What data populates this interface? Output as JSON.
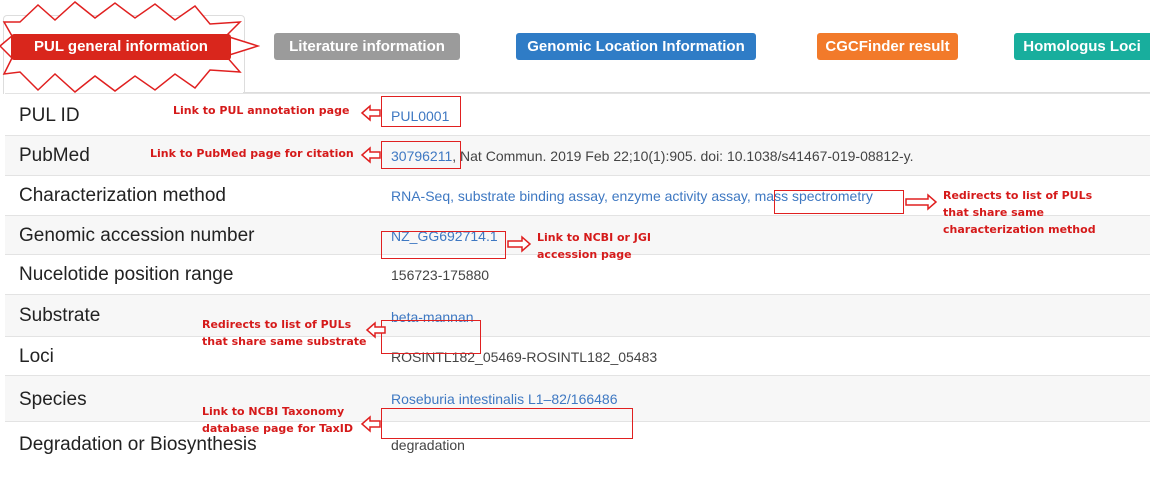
{
  "tabs": {
    "active": "PUL general information",
    "literature": "Literature information",
    "genomic": "Genomic Location Information",
    "cgc": "CGCFinder result",
    "homologus": "Homologus Loci"
  },
  "rows": [
    {
      "label": "PUL ID",
      "value": "PUL0001"
    },
    {
      "label": "PubMed",
      "value_link": "30796211",
      "value_rest": ", Nat Commun. 2019 Feb 22;10(1):905. doi: 10.1038/s41467-019-08812-y."
    },
    {
      "label": "Characterization method",
      "value_plain": "RNA-Seq, substrate binding assay, enzyme activity assay, ",
      "value_link": "mass spectrometry"
    },
    {
      "label": "Genomic accession number",
      "value": "NZ_GG692714.1"
    },
    {
      "label": "Nucelotide position range",
      "value": "156723-175880"
    },
    {
      "label": "Substrate",
      "value": "beta-mannan"
    },
    {
      "label": "Loci",
      "value": "ROSINTL182_05469-ROSINTL182_05483"
    },
    {
      "label": "Species",
      "value": "Roseburia intestinalis L1–82/166486"
    },
    {
      "label": "Degradation or Biosynthesis",
      "value": "degradation"
    }
  ],
  "annotations": {
    "pul_id": "Link to PUL annotation page",
    "pubmed": "Link to PubMed page for citation",
    "method_1": "Redirects to list of PULs",
    "method_2": "that share same",
    "method_3": "characterization method",
    "accession_1": "Link to NCBI or JGI",
    "accession_2": "accession page",
    "substrate_1": "Redirects to list of PULs",
    "substrate_2": "that share same substrate",
    "species_1": "Link to NCBI Taxonomy",
    "species_2": "database page for TaxID"
  }
}
